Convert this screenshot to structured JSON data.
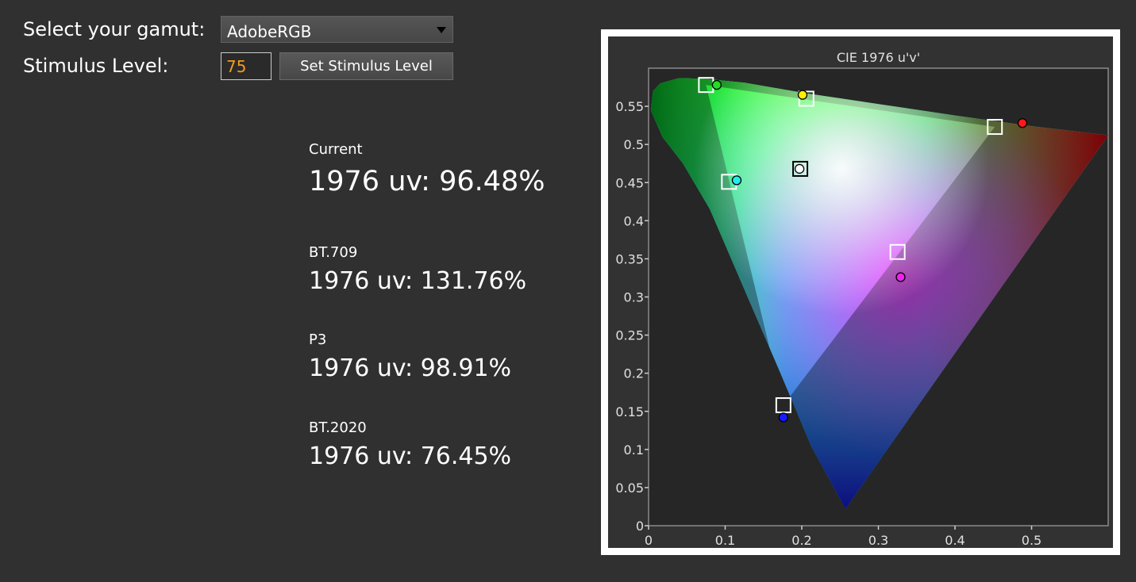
{
  "gamut": {
    "label": "Select your gamut:",
    "selected": "AdobeRGB"
  },
  "stimulus": {
    "label": "Stimulus Level:",
    "value": "75",
    "button_label": "Set Stimulus Level"
  },
  "stats": [
    {
      "title": "Current",
      "value": "1976 uv: 96.48%"
    },
    {
      "title": "BT.709",
      "value": "1976 uv: 131.76%"
    },
    {
      "title": "P3",
      "value": "1976 uv: 98.91%"
    },
    {
      "title": "BT.2020",
      "value": "1976 uv: 76.45%"
    }
  ],
  "colors": {
    "background": "#303030",
    "input_text": "#f29b1f",
    "frame": "#ffffff",
    "plot_background": "#262626"
  },
  "chart_data": {
    "type": "scatter",
    "title": "CIE 1976 u'v'",
    "xlabel": "",
    "ylabel": "",
    "xlim": [
      0,
      0.6
    ],
    "ylim": [
      0,
      0.6
    ],
    "x_ticks": [
      "0",
      "0.1",
      "0.2",
      "0.3",
      "0.4",
      "0.5"
    ],
    "y_ticks": [
      "0",
      "0.05",
      "0.1",
      "0.15",
      "0.2",
      "0.25",
      "0.3",
      "0.35",
      "0.4",
      "0.45",
      "0.5",
      "0.55"
    ],
    "spectral_locus": [
      [
        0.257,
        0.022
      ],
      [
        0.212,
        0.105
      ],
      [
        0.17,
        0.205
      ],
      [
        0.125,
        0.31
      ],
      [
        0.08,
        0.415
      ],
      [
        0.045,
        0.475
      ],
      [
        0.018,
        0.51
      ],
      [
        0.003,
        0.545
      ],
      [
        0.006,
        0.57
      ],
      [
        0.015,
        0.58
      ],
      [
        0.04,
        0.587
      ],
      [
        0.075,
        0.586
      ],
      [
        0.125,
        0.581
      ],
      [
        0.2,
        0.568
      ],
      [
        0.3,
        0.553
      ],
      [
        0.4,
        0.538
      ],
      [
        0.5,
        0.524
      ],
      [
        0.6,
        0.512
      ]
    ],
    "target_points": [
      {
        "name": "green-target",
        "u": 0.075,
        "v": 0.578
      },
      {
        "name": "yellow-target",
        "u": 0.206,
        "v": 0.56
      },
      {
        "name": "red-target",
        "u": 0.452,
        "v": 0.523
      },
      {
        "name": "cyan-target",
        "u": 0.105,
        "v": 0.451
      },
      {
        "name": "white-target",
        "u": 0.198,
        "v": 0.468
      },
      {
        "name": "magenta-target",
        "u": 0.325,
        "v": 0.359
      },
      {
        "name": "blue-target",
        "u": 0.176,
        "v": 0.158
      }
    ],
    "measured_points": [
      {
        "name": "green-measured",
        "u": 0.089,
        "v": 0.578,
        "color": "#22dd22"
      },
      {
        "name": "yellow-measured",
        "u": 0.201,
        "v": 0.565,
        "color": "#ffee00"
      },
      {
        "name": "red-measured",
        "u": 0.488,
        "v": 0.528,
        "color": "#ff1a1a"
      },
      {
        "name": "cyan-measured",
        "u": 0.115,
        "v": 0.453,
        "color": "#22eeee"
      },
      {
        "name": "white-measured",
        "u": 0.197,
        "v": 0.468,
        "color": "#ffffff"
      },
      {
        "name": "magenta-measured",
        "u": 0.329,
        "v": 0.326,
        "color": "#ee22ee"
      },
      {
        "name": "blue-measured",
        "u": 0.176,
        "v": 0.142,
        "color": "#1a1aff"
      }
    ]
  }
}
